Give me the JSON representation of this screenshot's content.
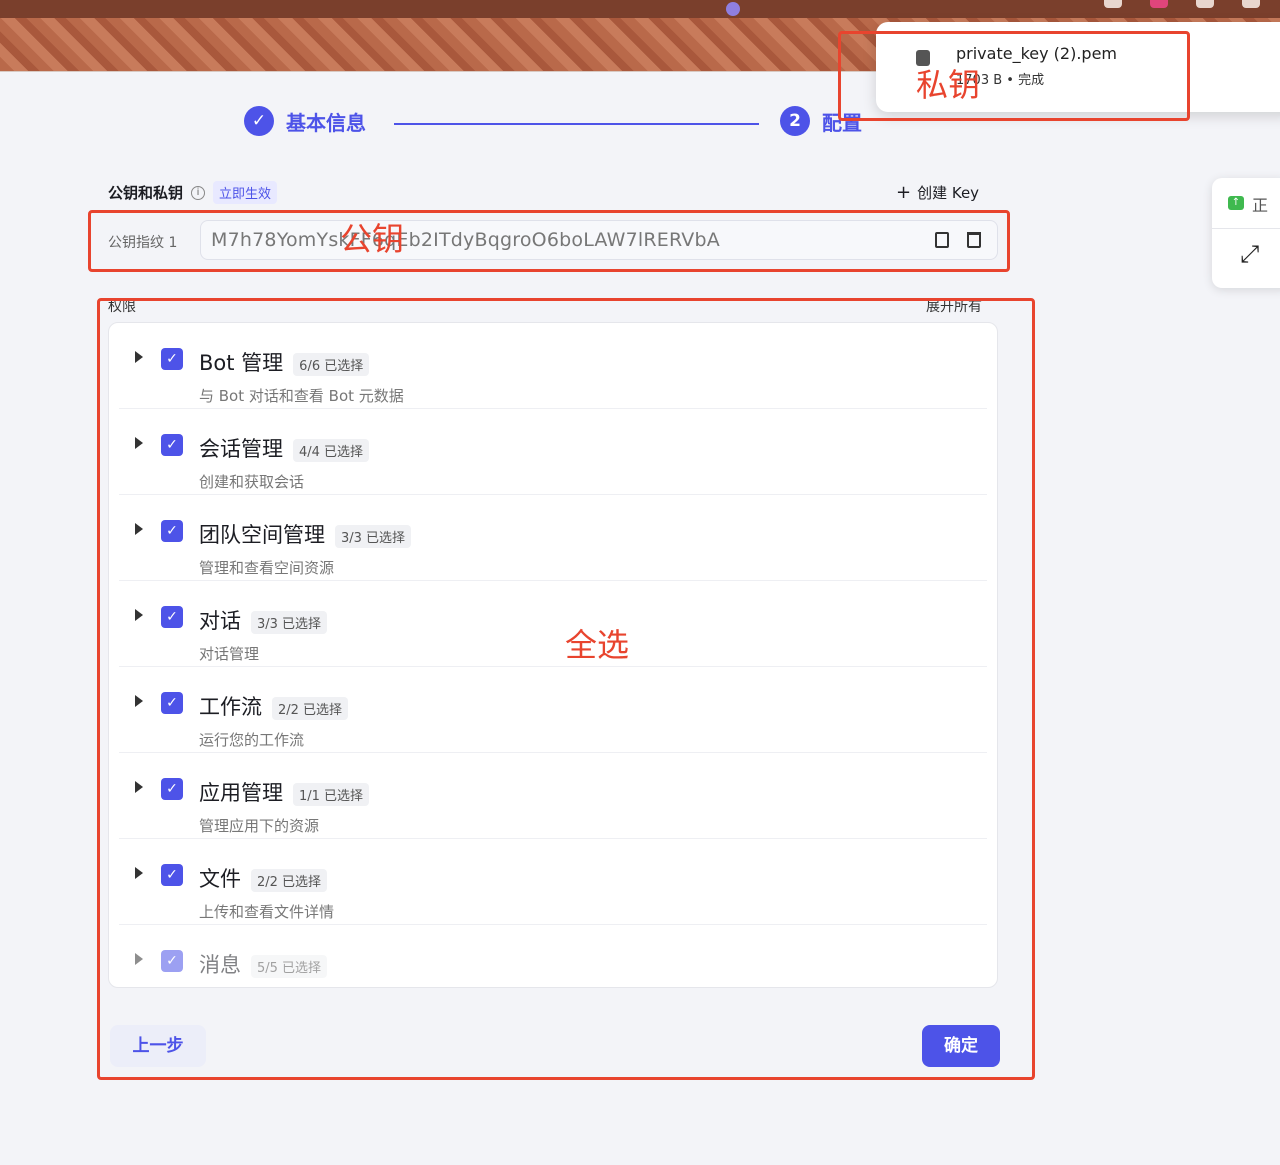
{
  "stepper": {
    "step1_label": "基本信息",
    "step1_icon": "check-icon",
    "step2_number": "2",
    "step2_label": "配置"
  },
  "download": {
    "file_name": "private_key (2).pem",
    "file_meta": "1703 B • 完成"
  },
  "side_widget": {
    "text": "正"
  },
  "keys": {
    "section_title": "公钥和私钥",
    "badge": "立即生效",
    "create_key": "创建 Key",
    "fingerprint_label": "公钥指纹 1",
    "fingerprint_value": "M7h78YomYskFF6qEb2ITdyBqgroO6boLAW7lRERVbA"
  },
  "permissions": {
    "label": "权限",
    "expand_all": "展开所有",
    "items": [
      {
        "title": "Bot 管理",
        "count": "6/6 已选择",
        "desc": "与 Bot 对话和查看 Bot 元数据",
        "checked": true
      },
      {
        "title": "会话管理",
        "count": "4/4 已选择",
        "desc": "创建和获取会话",
        "checked": true
      },
      {
        "title": "团队空间管理",
        "count": "3/3 已选择",
        "desc": "管理和查看空间资源",
        "checked": true
      },
      {
        "title": "对话",
        "count": "3/3 已选择",
        "desc": "对话管理",
        "checked": true
      },
      {
        "title": "工作流",
        "count": "2/2 已选择",
        "desc": "运行您的工作流",
        "checked": true
      },
      {
        "title": "应用管理",
        "count": "1/1 已选择",
        "desc": "管理应用下的资源",
        "checked": true
      },
      {
        "title": "文件",
        "count": "2/2 已选择",
        "desc": "上传和查看文件详情",
        "checked": true
      },
      {
        "title": "消息",
        "count": "5/5 已选择",
        "desc": "",
        "checked": true
      }
    ]
  },
  "buttons": {
    "prev": "上一步",
    "confirm": "确定"
  },
  "annotations": {
    "private_key": "私钥",
    "public_key": "公钥",
    "select_all": "全选",
    "color": "#e8442e"
  },
  "colors": {
    "accent": "#4d53e8"
  }
}
